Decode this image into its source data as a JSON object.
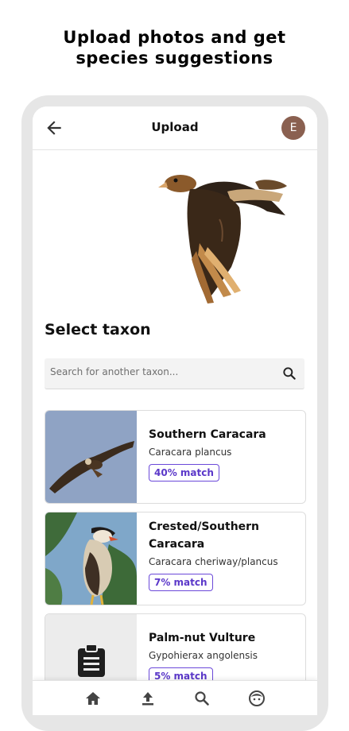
{
  "promo": {
    "line1": "Upload photos and get",
    "line2": "species suggestions"
  },
  "appbar": {
    "title": "Upload",
    "avatar_letter": "E"
  },
  "section": {
    "title": "Select taxon"
  },
  "search": {
    "placeholder": "Search for another taxon..."
  },
  "results": [
    {
      "name": "Southern Caracara",
      "scientific": "Caracara plancus",
      "match": "40% match"
    },
    {
      "name": "Crested/Southern Caracara",
      "scientific": "Caracara cheriway/plancus",
      "match": "7% match"
    },
    {
      "name": "Palm-nut Vulture",
      "scientific": "Gypohierax angolensis",
      "match": "5% match"
    }
  ],
  "nav": [
    "home-icon",
    "upload-icon",
    "search-icon",
    "profile-icon"
  ],
  "colors": {
    "accent": "#5b38c9",
    "avatar": "#8a6050"
  }
}
